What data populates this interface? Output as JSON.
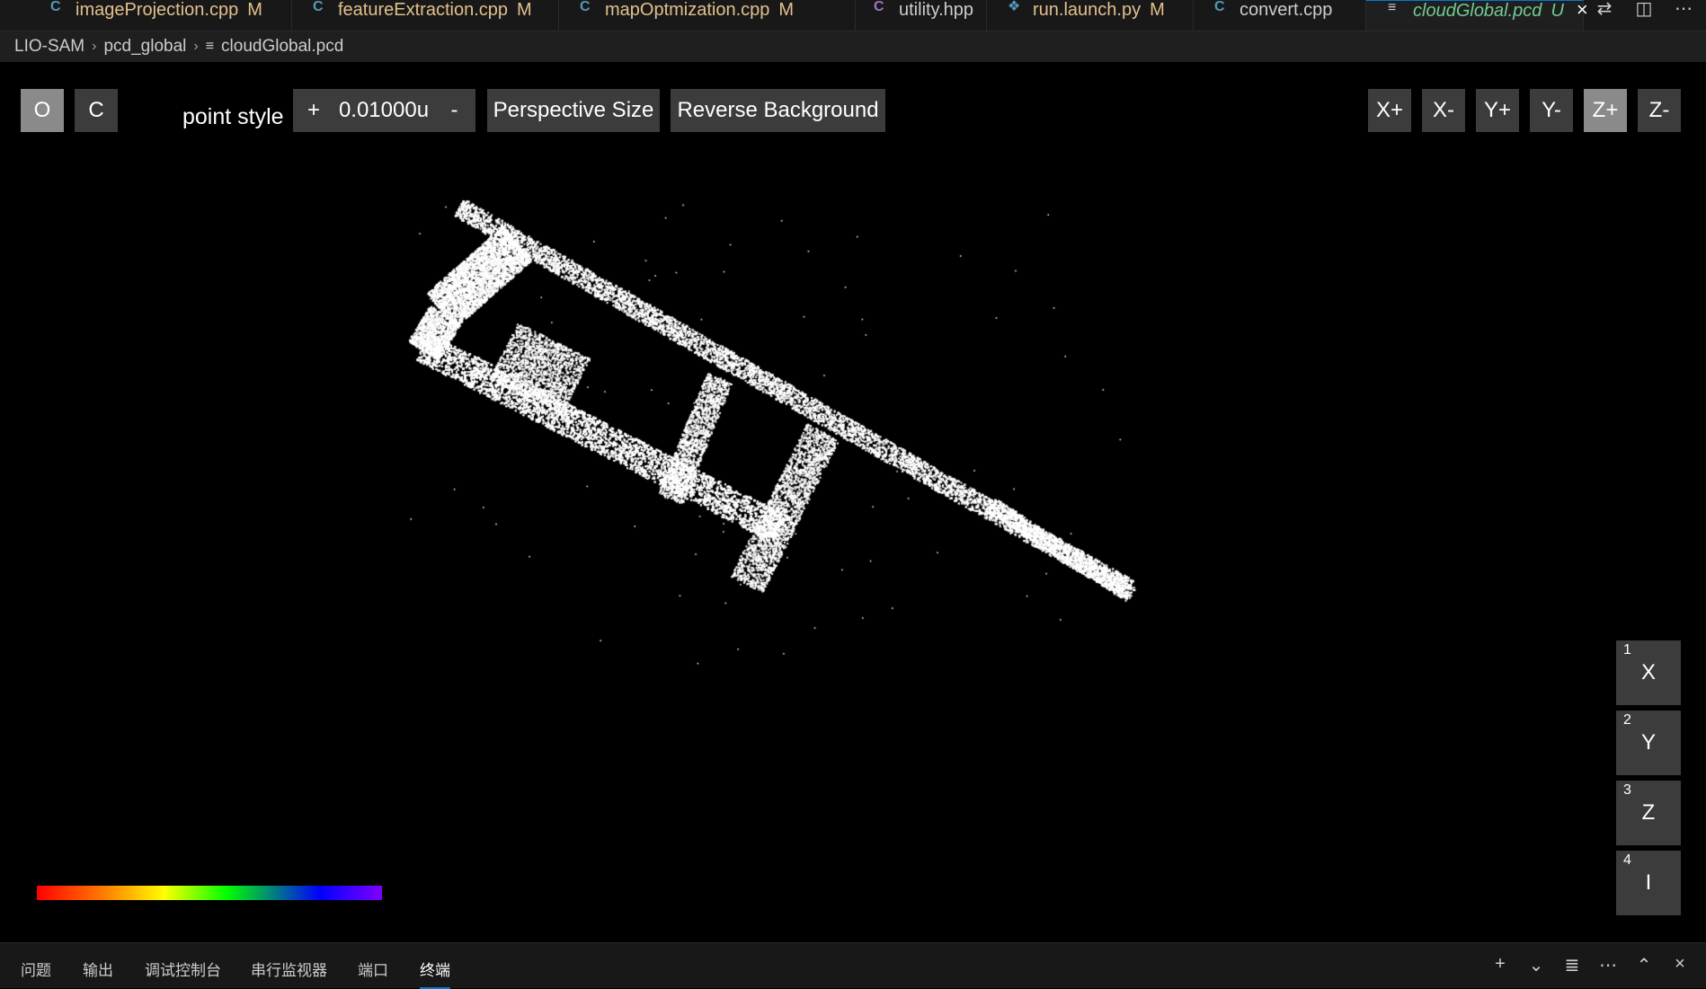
{
  "tabs": [
    {
      "label": "imageProjection.cpp",
      "status": "M",
      "icon": "C",
      "icon_color": "#519aba",
      "kind": "modified"
    },
    {
      "label": "featureExtraction.cpp",
      "status": "M",
      "icon": "C",
      "icon_color": "#519aba",
      "kind": "modified"
    },
    {
      "label": "mapOptmization.cpp",
      "status": "M",
      "icon": "C",
      "icon_color": "#519aba",
      "kind": "modified"
    },
    {
      "label": "utility.hpp",
      "status": "",
      "icon": "C",
      "icon_color": "#a074c4",
      "kind": "normal"
    },
    {
      "label": "run.launch.py",
      "status": "M",
      "icon": "❖",
      "icon_color": "#519aba",
      "kind": "modified"
    },
    {
      "label": "convert.cpp",
      "status": "",
      "icon": "C",
      "icon_color": "#519aba",
      "kind": "normal"
    },
    {
      "label": "cloudGlobal.pcd",
      "status": "U",
      "icon": "≡",
      "icon_color": "#cccccc",
      "kind": "untracked",
      "close": "×"
    }
  ],
  "editor_actions": [
    "compare-icon",
    "split-editor-icon",
    "more-icon"
  ],
  "editor_action_glyphs": [
    "⇄",
    "◫",
    "⋯"
  ],
  "breadcrumb": {
    "project": "LIO-SAM",
    "folder": "pcd_global",
    "file": "cloudGlobal.pcd",
    "sep": "›",
    "file_icon": "≡"
  },
  "viewer": {
    "buttons": {
      "orthographic": "O",
      "close": "C",
      "point_style_label": "point style",
      "plus": "+",
      "point_size": "0.01000u",
      "minus": "-",
      "perspective_size": "Perspective Size",
      "reverse_background": "Reverse Background"
    },
    "view_buttons": [
      "X+",
      "X-",
      "Y+",
      "Y-",
      "Z+",
      "Z-"
    ],
    "selected_view": "Z+",
    "axis_buttons": [
      {
        "num": "1",
        "label": "X"
      },
      {
        "num": "2",
        "label": "Y"
      },
      {
        "num": "3",
        "label": "Z"
      },
      {
        "num": "4",
        "label": "I"
      }
    ],
    "colorbar_colors": [
      "#ff0000",
      "#ff8000",
      "#ffff00",
      "#00ff00",
      "#0000ff",
      "#8000ff"
    ]
  },
  "panel": {
    "tabs": [
      "问题",
      "输出",
      "调试控制台",
      "串行监视器",
      "端口",
      "终端"
    ],
    "active_tab": "终端",
    "actions": [
      "plus-icon",
      "chevron-down-icon",
      "clear-icon",
      "more-icon",
      "maximize-icon",
      "close-icon"
    ],
    "action_glyphs": [
      "+",
      "⌄",
      "≣",
      "⋯",
      "⌃",
      "×"
    ]
  }
}
